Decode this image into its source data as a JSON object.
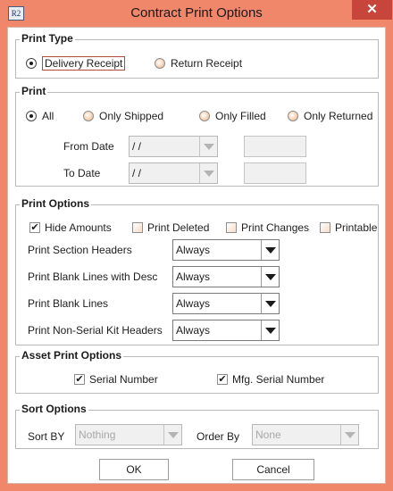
{
  "window": {
    "title": "Contract Print Options",
    "icon_text": "R2",
    "close_glyph": "✕"
  },
  "print_type": {
    "title": "Print Type",
    "options": [
      "Delivery Receipt",
      "Return Receipt"
    ],
    "selected": "Delivery Receipt"
  },
  "print": {
    "title": "Print",
    "options": [
      "All",
      "Only Shipped",
      "Only Filled",
      "Only Returned"
    ],
    "selected": "All",
    "from_date_label": "From Date",
    "from_date_value": "/ /",
    "to_date_label": "To Date",
    "to_date_value": "/ /"
  },
  "print_options": {
    "title": "Print Options",
    "checkboxes": [
      {
        "label": "Hide Amounts",
        "checked": true
      },
      {
        "label": "Print Deleted",
        "checked": false
      },
      {
        "label": "Print Changes",
        "checked": false
      },
      {
        "label": "Printable",
        "checked": false
      }
    ],
    "rows": [
      {
        "label": "Print Section Headers",
        "value": "Always"
      },
      {
        "label": "Print Blank Lines with Desc",
        "value": "Always"
      },
      {
        "label": "Print Blank Lines",
        "value": "Always"
      },
      {
        "label": "Print Non-Serial Kit Headers",
        "value": "Always"
      }
    ]
  },
  "asset_print_options": {
    "title": "Asset Print Options",
    "checkboxes": [
      {
        "label": "Serial Number",
        "checked": true
      },
      {
        "label": "Mfg. Serial Number",
        "checked": true
      }
    ]
  },
  "sort_options": {
    "title": "Sort Options",
    "sort_by_label": "Sort BY",
    "sort_by_value": "Nothing",
    "order_by_label": "Order By",
    "order_by_value": "None"
  },
  "buttons": {
    "ok": "OK",
    "cancel": "Cancel"
  },
  "colors": {
    "title_bar": "#f0866a",
    "close_button": "#c7453b",
    "focus_border": "#b04a3a"
  },
  "icons": {
    "close": "close-icon",
    "app": "r2-app-icon",
    "dropdown": "chevron-down-icon"
  },
  "check_glyph": "✔"
}
